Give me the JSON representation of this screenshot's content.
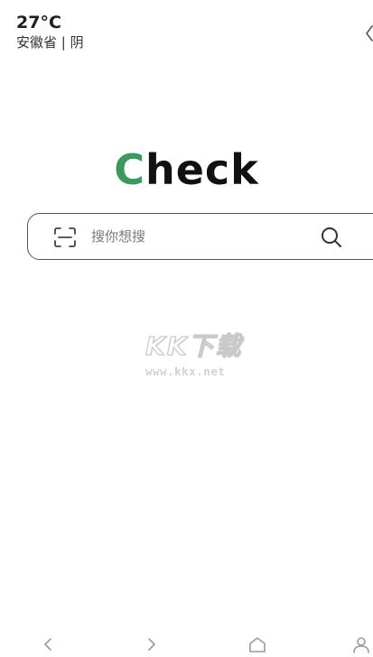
{
  "status": {
    "temperature": "27°C",
    "location_weather": "安徽省 | 阴"
  },
  "logo": {
    "first_letter": "C",
    "rest": "heck"
  },
  "search": {
    "placeholder": "搜你想搜"
  },
  "watermark": {
    "main": "KK下载",
    "url": "www.kkx.net"
  },
  "colors": {
    "logo_accent": "#3a9a5c",
    "text_dark": "#111111",
    "placeholder": "#7a7a7a",
    "nav_icon": "#9a9a9a"
  },
  "icons": {
    "top_right": "share-icon",
    "scan": "scan-icon",
    "search": "search-icon",
    "nav_back": "chevron-left-icon",
    "nav_forward": "chevron-right-icon",
    "nav_home": "home-icon",
    "nav_profile": "user-icon"
  }
}
